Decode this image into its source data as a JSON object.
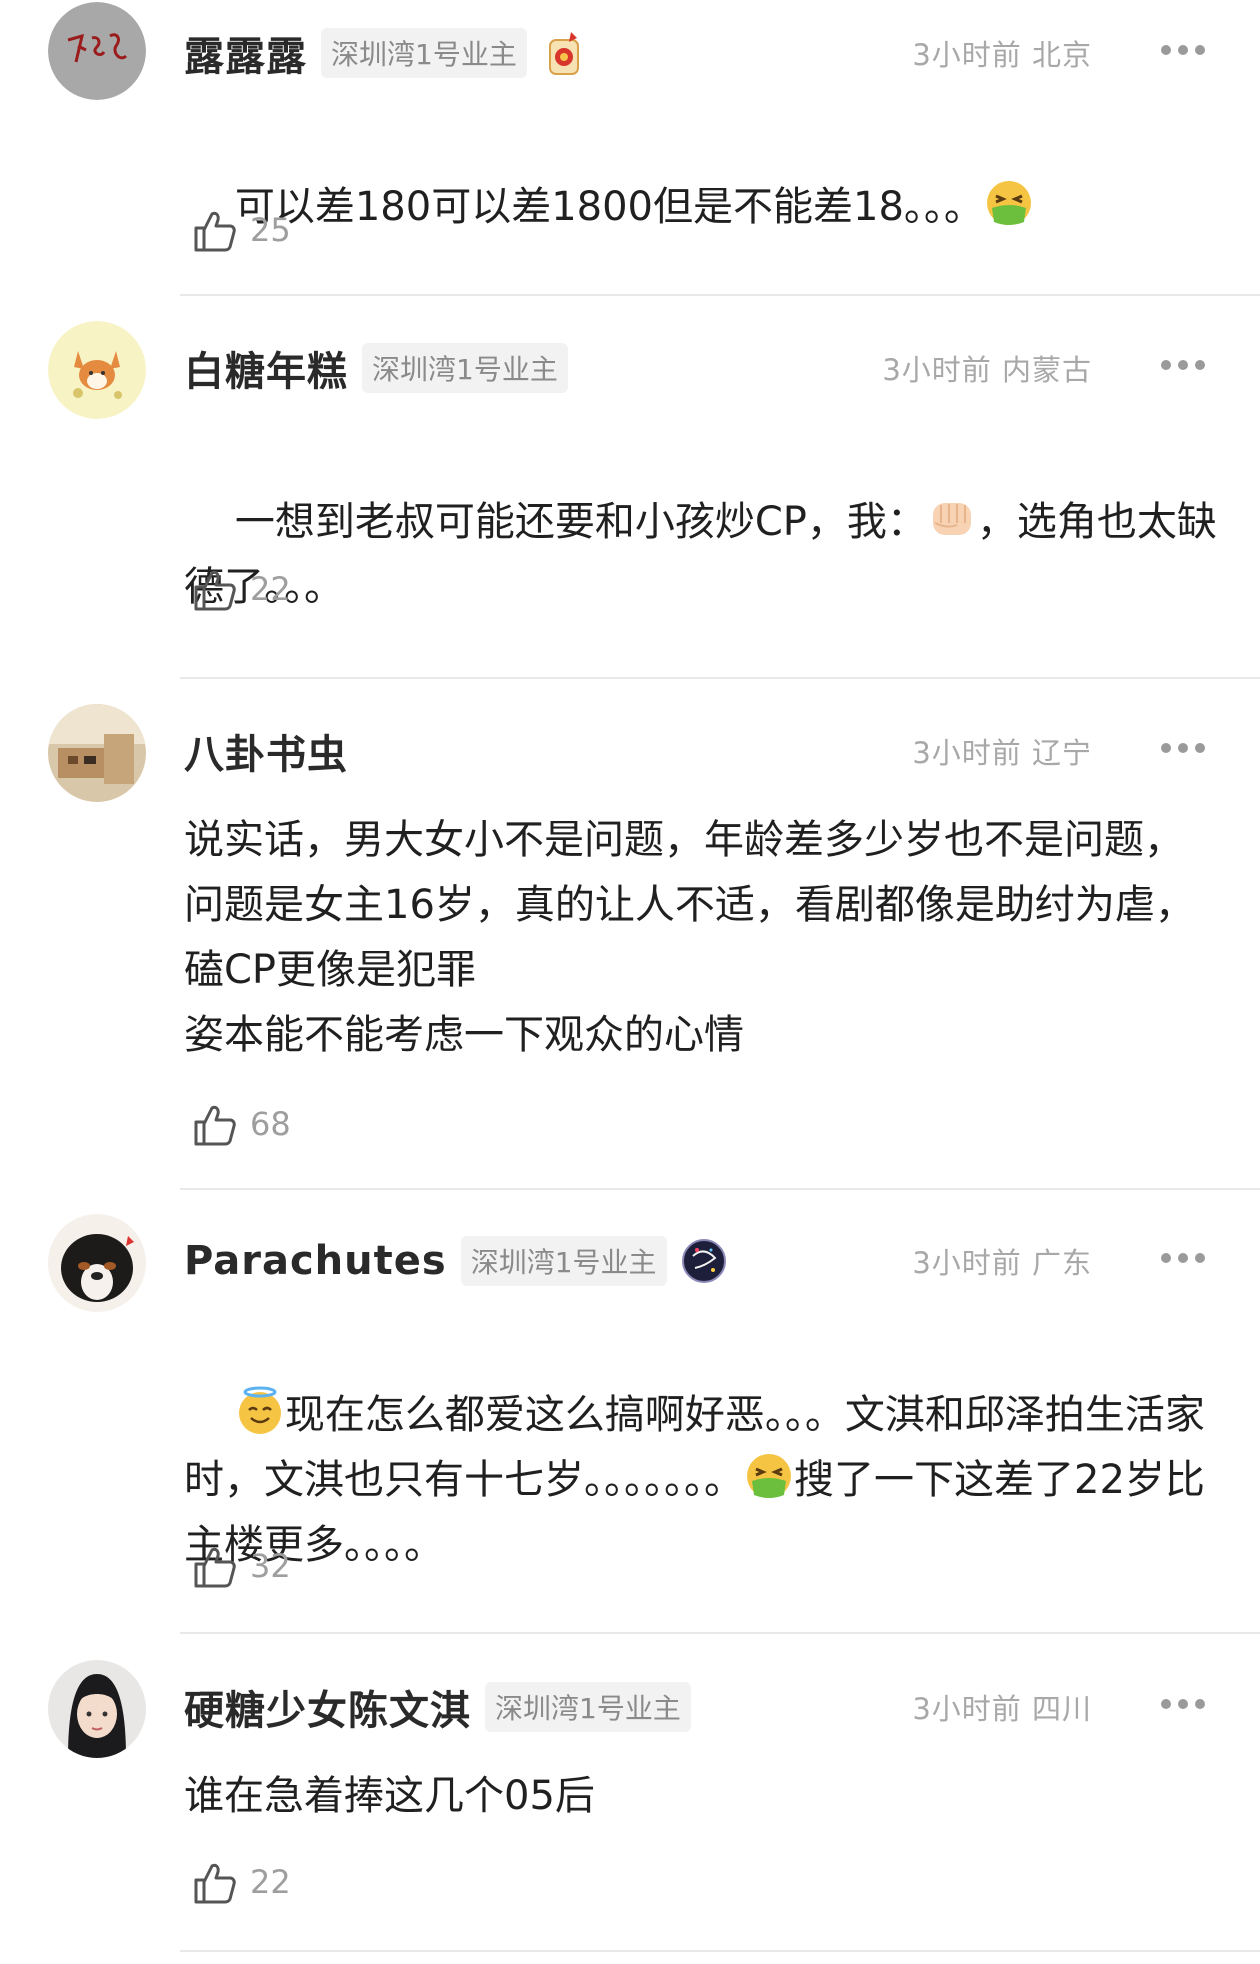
{
  "comments": [
    {
      "username": "露露露",
      "badge": "深圳湾1号业主",
      "medal_icon": "lantern-medal-icon",
      "meta": "3小时前 北京",
      "text_parts": [
        "可以差180可以差1800但是不能差18。。。"
      ],
      "emoji_icon": "nauseated-emoji-icon",
      "likes": "25",
      "avatar_icon": "calligraphy-avatar"
    },
    {
      "username": "白糖年糕",
      "badge": "深圳湾1号业主",
      "meta": "3小时前 内蒙古",
      "text_parts": [
        "一想到老叔可能还要和小孩炒CP，我：",
        "，选角也太缺德了。。。"
      ],
      "emoji_icon": "fist-emoji-icon",
      "likes": "22",
      "avatar_icon": "fox-avatar"
    },
    {
      "username": "八卦书虫",
      "meta": "3小时前 辽宁",
      "text": "说实话，男大女小不是问题，年龄差多少岁也不是问题，问题是女主16岁，真的让人不适，看剧都像是助纣为虐，磕CP更像是犯罪\n姿本能不能考虑一下观众的心情",
      "likes": "68",
      "avatar_icon": "room-photo-avatar"
    },
    {
      "username": "Parachutes",
      "badge": "深圳湾1号业主",
      "medal_icon": "starry-medal-icon",
      "meta": "3小时前 广东",
      "text_parts": [
        "现在怎么都爱这么搞啊好恶。。。文淇和邱泽拍生活家时，文淇也只有十七岁。。。。。。。",
        "搜了一下这差了22岁比主楼更多。。。。"
      ],
      "emoji_icons": [
        "halo-smile-emoji-icon",
        "nauseated-emoji-icon"
      ],
      "likes": "32",
      "avatar_icon": "dog-avatar"
    },
    {
      "username": "硬糖少女陈文淇",
      "badge": "深圳湾1号业主",
      "meta": "3小时前 四川",
      "text": "谁在急着捧这几个05后",
      "likes": "22",
      "avatar_icon": "girl-avatar"
    }
  ],
  "colors": {
    "username": "#2a2a2a",
    "meta": "#a8a8a8",
    "badge_bg": "#f2f2f2",
    "divider": "#e8e8e8"
  }
}
